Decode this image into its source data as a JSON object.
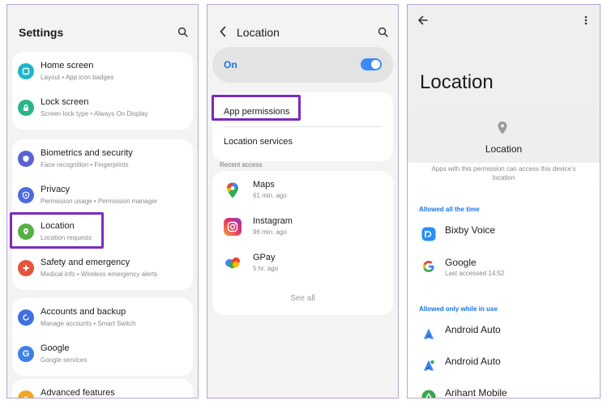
{
  "settings_panel": {
    "title": "Settings",
    "items": [
      {
        "title": "Home screen",
        "subtitle": "Layout  •  App icon badges",
        "icon": "home-screen-icon",
        "color": "#1fb6c9"
      },
      {
        "title": "Lock screen",
        "subtitle": "Screen lock type  •  Always On Display",
        "icon": "lock-screen-icon",
        "color": "#2db58a"
      },
      {
        "title": "Biometrics and security",
        "subtitle": "Face recognition  •  Fingerprints",
        "icon": "shield-icon",
        "color": "#5a63d6"
      },
      {
        "title": "Privacy",
        "subtitle": "Permission usage  •  Permission manager",
        "icon": "privacy-icon",
        "color": "#4d6bdf"
      },
      {
        "title": "Location",
        "subtitle": "Location requests",
        "icon": "location-pin-icon",
        "color": "#55b046"
      },
      {
        "title": "Safety and emergency",
        "subtitle": "Medical info  •  Wireless emergency alerts",
        "icon": "emergency-icon",
        "color": "#e5533d"
      },
      {
        "title": "Accounts and backup",
        "subtitle": "Manage accounts  •  Smart Switch",
        "icon": "sync-icon",
        "color": "#3f6fe0"
      },
      {
        "title": "Google",
        "subtitle": "Google services",
        "icon": "google-g-icon",
        "color": "#3f7fe6"
      },
      {
        "title": "Advanced features",
        "subtitle": "",
        "icon": "advanced-icon",
        "color": "#f0a727"
      }
    ]
  },
  "location_panel": {
    "title": "Location",
    "toggle_label": "On",
    "toggle_on": true,
    "app_permissions": "App permissions",
    "location_services": "Location services",
    "recent_access_label": "Recent access",
    "recent": [
      {
        "name": "Maps",
        "time": "61 min. ago",
        "icon": "google-maps-icon"
      },
      {
        "name": "Instagram",
        "time": "96 min. ago",
        "icon": "instagram-icon"
      },
      {
        "name": "GPay",
        "time": "5 hr. ago",
        "icon": "gpay-icon"
      }
    ],
    "see_all": "See all"
  },
  "permission_panel": {
    "title": "Location",
    "permission_name": "Location",
    "description": "Apps with this permission can access this device's location",
    "allowed_all_label": "Allowed all the time",
    "allowed_all": [
      {
        "name": "Bixby Voice",
        "detail": "",
        "icon": "bixby-icon"
      },
      {
        "name": "Google",
        "detail": "Last accessed 14:52",
        "icon": "google-g-icon"
      }
    ],
    "allowed_while_label": "Allowed only while in use",
    "allowed_while": [
      {
        "name": "Android Auto",
        "detail": "",
        "icon": "android-auto-icon"
      },
      {
        "name": "Android Auto",
        "detail": "",
        "icon": "android-auto-icon"
      },
      {
        "name": "Arihant Mobile",
        "detail": "",
        "icon": "arihant-icon"
      }
    ]
  },
  "colors": {
    "highlight": "#7b2bbd",
    "accent_blue": "#1a73e8",
    "switch_on": "#3d8af7"
  }
}
